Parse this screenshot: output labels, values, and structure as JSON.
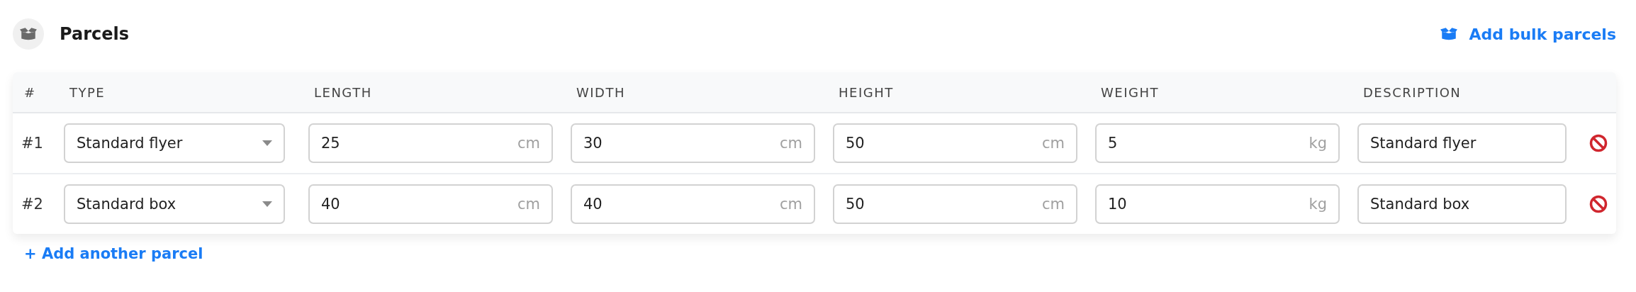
{
  "header": {
    "title": "Parcels",
    "action": "Add bulk parcels"
  },
  "table": {
    "columns": [
      "#",
      "TYPE",
      "LENGTH",
      "WIDTH",
      "HEIGHT",
      "WEIGHT",
      "DESCRIPTION"
    ],
    "rows": [
      {
        "number": "#1",
        "type": "Standard flyer",
        "measures": [
          {
            "value": "25",
            "unit": "cm"
          },
          {
            "value": "30",
            "unit": "cm"
          },
          {
            "value": "50",
            "unit": "cm"
          },
          {
            "value": "5",
            "unit": "kg"
          }
        ],
        "description": "Standard flyer"
      },
      {
        "number": "#2",
        "type": "Standard box",
        "measures": [
          {
            "value": "40",
            "unit": "cm"
          },
          {
            "value": "40",
            "unit": "cm"
          },
          {
            "value": "50",
            "unit": "cm"
          },
          {
            "value": "10",
            "unit": "kg"
          }
        ],
        "description": "Standard box"
      }
    ]
  },
  "add_link": "+ Add another parcel"
}
